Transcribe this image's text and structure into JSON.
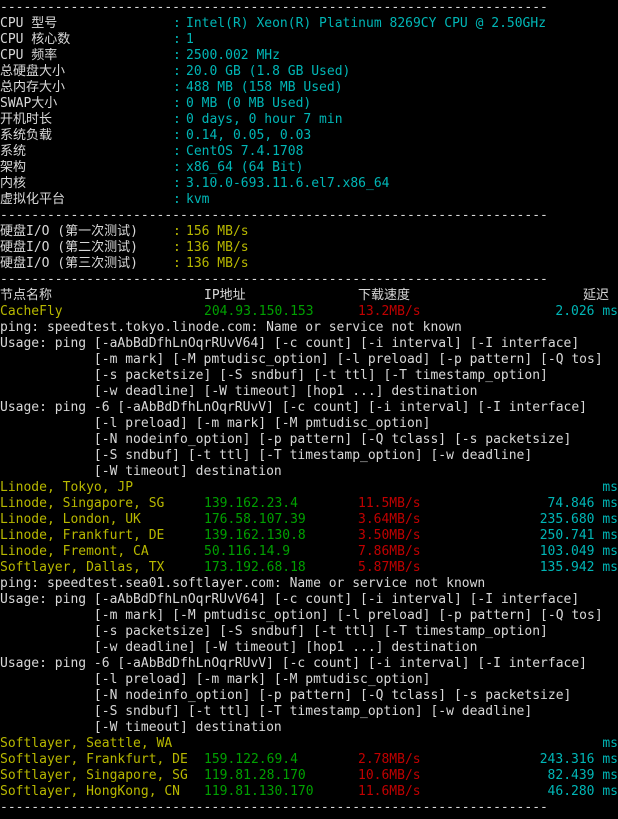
{
  "colors": {
    "background": "#000000",
    "default_text": "#d8d8d8",
    "value_cyan": "#00b6b6",
    "ip_green": "#00a000",
    "speed_red": "#c00000",
    "name_yellow": "#b8b800",
    "io_yellow": "#b8b800"
  },
  "separator": "----------------------------------------------------------------------",
  "system_info": {
    "rows": [
      {
        "label": "CPU 型号",
        "colon": ":",
        "value": "Intel(R) Xeon(R) Platinum 8269CY CPU @ 2.50GHz"
      },
      {
        "label": "CPU 核心数",
        "colon": ":",
        "value": "1"
      },
      {
        "label": "CPU 频率",
        "colon": ":",
        "value": "2500.002 MHz"
      },
      {
        "label": "总硬盘大小",
        "colon": ":",
        "value": "20.0 GB (1.8 GB Used)"
      },
      {
        "label": "总内存大小",
        "colon": ":",
        "value": "488 MB (158 MB Used)"
      },
      {
        "label": "SWAP大小",
        "colon": ":",
        "value": "0 MB (0 MB Used)"
      },
      {
        "label": "开机时长",
        "colon": ":",
        "value": "0 days, 0 hour 7 min"
      },
      {
        "label": "系统负载",
        "colon": ":",
        "value": "0.14, 0.05, 0.03"
      },
      {
        "label": "系统",
        "colon": ":",
        "value": "CentOS 7.4.1708"
      },
      {
        "label": "架构",
        "colon": ":",
        "value": "x86_64 (64 Bit)"
      },
      {
        "label": "内核",
        "colon": ":",
        "value": "3.10.0-693.11.6.el7.x86_64"
      },
      {
        "label": "虚拟化平台",
        "colon": ":",
        "value": "kvm"
      }
    ]
  },
  "disk_io": {
    "rows": [
      {
        "label": "硬盘I/O (第一次测试)",
        "colon": ":",
        "value": "156 MB/s"
      },
      {
        "label": "硬盘I/O (第二次测试)",
        "colon": ":",
        "value": "136 MB/s"
      },
      {
        "label": "硬盘I/O (第三次测试)",
        "colon": ":",
        "value": "136 MB/s"
      }
    ]
  },
  "speedtest": {
    "header": {
      "name": "节点名称",
      "ip": "IP地址",
      "speed": "下载速度",
      "latency": "延迟"
    },
    "cachefly": {
      "name": "CacheFly",
      "ip": "204.93.150.153",
      "speed": "13.2MB/s",
      "latency": "2.026 ms"
    },
    "linode_error": "ping: speedtest.tokyo.linode.com: Name or service not known",
    "softlayer_error": "ping: speedtest.sea01.softlayer.com: Name or service not known",
    "linode_rows": [
      {
        "name": "Linode, Tokyo, JP",
        "ip": "",
        "speed": "",
        "latency": "ms"
      },
      {
        "name": "Linode, Singapore, SG",
        "ip": "139.162.23.4",
        "speed": "11.5MB/s",
        "latency": "74.846 ms"
      },
      {
        "name": "Linode, London, UK",
        "ip": "176.58.107.39",
        "speed": "3.64MB/s",
        "latency": "235.680 ms"
      },
      {
        "name": "Linode, Frankfurt, DE",
        "ip": "139.162.130.8",
        "speed": "3.50MB/s",
        "latency": "250.741 ms"
      },
      {
        "name": "Linode, Fremont, CA",
        "ip": "50.116.14.9",
        "speed": "7.86MB/s",
        "latency": "103.049 ms"
      },
      {
        "name": "Softlayer, Dallas, TX",
        "ip": "173.192.68.18",
        "speed": "5.87MB/s",
        "latency": "135.942 ms"
      }
    ],
    "softlayer_rows": [
      {
        "name": "Softlayer, Seattle, WA",
        "ip": "",
        "speed": "",
        "latency": "ms"
      },
      {
        "name": "Softlayer, Frankfurt, DE",
        "ip": "159.122.69.4",
        "speed": "2.78MB/s",
        "latency": "243.316 ms"
      },
      {
        "name": "Softlayer, Singapore, SG",
        "ip": "119.81.28.170",
        "speed": "10.6MB/s",
        "latency": "82.439 ms"
      },
      {
        "name": "Softlayer, HongKong, CN",
        "ip": "119.81.130.170",
        "speed": "11.6MB/s",
        "latency": "46.280 ms"
      }
    ]
  },
  "ping_usage": {
    "lines": [
      "Usage: ping [-aAbBdDfhLnOqrRUvV64] [-c count] [-i interval] [-I interface]",
      "            [-m mark] [-M pmtudisc_option] [-l preload] [-p pattern] [-Q tos]",
      "            [-s packetsize] [-S sndbuf] [-t ttl] [-T timestamp_option]",
      "            [-w deadline] [-W timeout] [hop1 ...] destination",
      "Usage: ping -6 [-aAbBdDfhLnOqrRUvV] [-c count] [-i interval] [-I interface]",
      "            [-l preload] [-m mark] [-M pmtudisc_option]",
      "            [-N nodeinfo_option] [-p pattern] [-Q tclass] [-s packetsize]",
      "            [-S sndbuf] [-t ttl] [-T timestamp_option] [-w deadline]",
      "            [-W timeout] destination"
    ]
  }
}
